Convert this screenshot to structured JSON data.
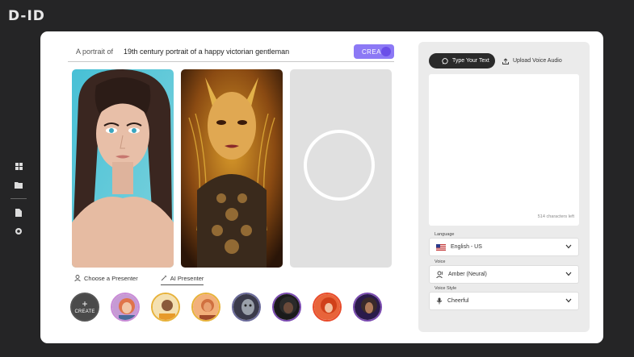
{
  "app": {
    "logo_text": "D-ID"
  },
  "sidebar": {
    "items": [
      {
        "icon": "grid-icon"
      },
      {
        "icon": "folder-icon"
      },
      {
        "icon": "document-icon"
      },
      {
        "icon": "settings-icon"
      }
    ]
  },
  "prompt": {
    "label": "A portrait of",
    "value": "19th century portrait of a happy victorian gentleman",
    "create_label": "CREA"
  },
  "presenter_tabs": [
    {
      "label": "Choose a Presenter",
      "icon": "person-icon",
      "active": false
    },
    {
      "label": "AI Presenter",
      "icon": "sparkle-icon",
      "active": true
    }
  ],
  "avatars": {
    "create_label": "CREATE",
    "create_icon": "+"
  },
  "right_panel": {
    "tabs": [
      {
        "label": "Type Your Text",
        "icon": "chat-icon",
        "active": true
      },
      {
        "label": "Upload Voice Audio",
        "icon": "upload-icon",
        "active": false
      }
    ],
    "char_count": "514 characters left",
    "language": {
      "label": "Language",
      "value": "English - US",
      "icon": "us-flag-icon"
    },
    "voice": {
      "label": "Voice",
      "value": "Amber (Neural)",
      "icon": "voice-person-icon"
    },
    "voice_style": {
      "label": "Voice Style",
      "value": "Cheerful",
      "icon": "microphone-icon"
    }
  },
  "colors": {
    "background": "#252526",
    "accent": "#8c79f5",
    "card": "#ffffff",
    "panel": "#ebebeb"
  }
}
